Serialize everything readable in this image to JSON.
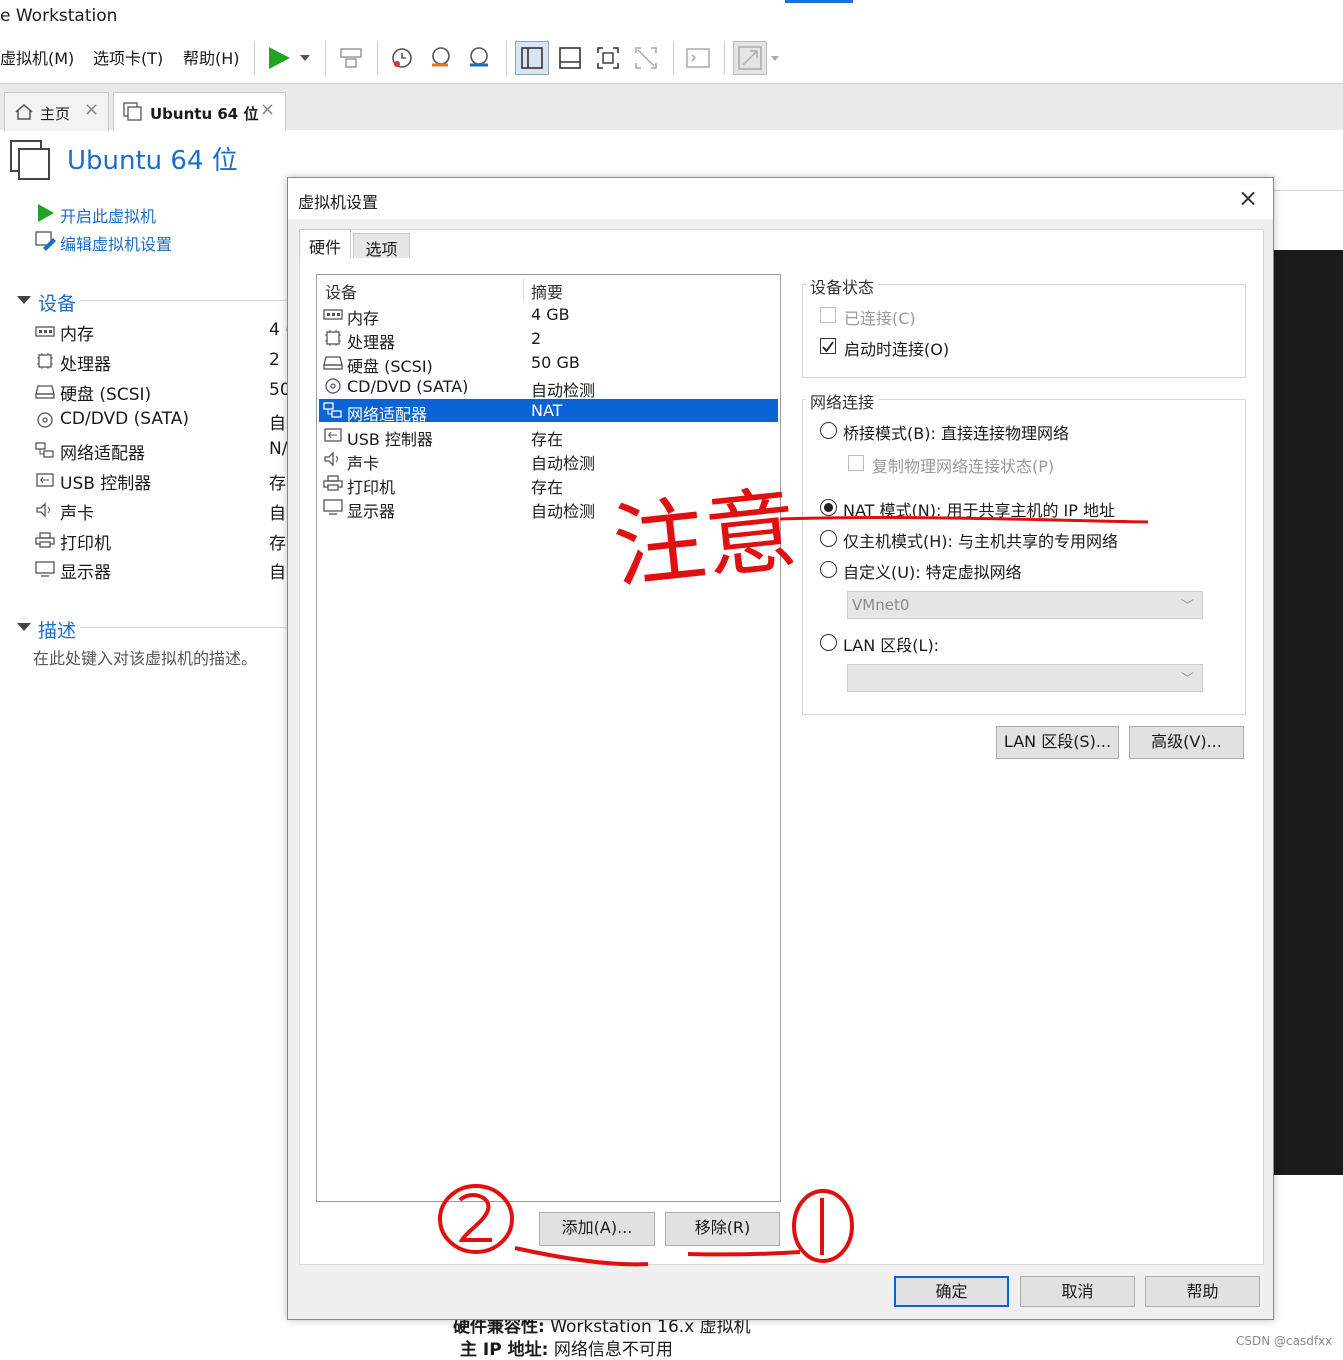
{
  "app": {
    "title": "e Workstation"
  },
  "menu": {
    "vm": "虚拟机(M)",
    "tabs": "选项卡(T)",
    "help": "帮助(H)"
  },
  "tabs": [
    {
      "label": "主页"
    },
    {
      "label": "Ubuntu 64 位"
    }
  ],
  "vm": {
    "title": "Ubuntu 64 位",
    "actions": {
      "power_on": "开启此虚拟机",
      "edit_settings": "编辑虚拟机设置"
    },
    "devices_header": "设备",
    "devices": [
      {
        "name": "内存",
        "value": "4 (",
        "icon": "memory-icon"
      },
      {
        "name": "处理器",
        "value": "2",
        "icon": "cpu-icon"
      },
      {
        "name": "硬盘 (SCSI)",
        "value": "50",
        "icon": "disk-icon"
      },
      {
        "name": "CD/DVD (SATA)",
        "value": "自",
        "icon": "cd-icon"
      },
      {
        "name": "网络适配器",
        "value": "N/",
        "icon": "network-icon"
      },
      {
        "name": "USB 控制器",
        "value": "存",
        "icon": "usb-icon"
      },
      {
        "name": "声卡",
        "value": "自",
        "icon": "sound-icon"
      },
      {
        "name": "打印机",
        "value": "存",
        "icon": "printer-icon"
      },
      {
        "name": "显示器",
        "value": "自",
        "icon": "monitor-icon"
      }
    ],
    "description_header": "描述",
    "description_placeholder": "在此处键入对该虚拟机的描述。",
    "details": [
      {
        "label": "硬件兼容性:",
        "value": "Workstation 16.x 虚拟机"
      },
      {
        "label": "主 IP 地址:",
        "value": "网络信息不可用"
      }
    ]
  },
  "dialog": {
    "title": "虚拟机设置",
    "tabs": {
      "hardware": "硬件",
      "options": "选项"
    },
    "list_headers": {
      "device": "设备",
      "summary": "摘要"
    },
    "devices": [
      {
        "name": "内存",
        "summary": "4 GB",
        "icon": "memory-icon"
      },
      {
        "name": "处理器",
        "summary": "2",
        "icon": "cpu-icon"
      },
      {
        "name": "硬盘 (SCSI)",
        "summary": "50 GB",
        "icon": "disk-icon"
      },
      {
        "name": "CD/DVD (SATA)",
        "summary": "自动检测",
        "icon": "cd-icon"
      },
      {
        "name": "网络适配器",
        "summary": "NAT",
        "icon": "network-icon",
        "selected": true
      },
      {
        "name": "USB 控制器",
        "summary": "存在",
        "icon": "usb-icon"
      },
      {
        "name": "声卡",
        "summary": "自动检测",
        "icon": "sound-icon"
      },
      {
        "name": "打印机",
        "summary": "存在",
        "icon": "printer-icon"
      },
      {
        "name": "显示器",
        "summary": "自动检测",
        "icon": "monitor-icon"
      }
    ],
    "device_status": {
      "label": "设备状态",
      "connected": {
        "label": "已连接(C)",
        "checked": false,
        "enabled": false
      },
      "connect_at_power_on": {
        "label": "启动时连接(O)",
        "checked": true,
        "enabled": true
      }
    },
    "network_connection": {
      "label": "网络连接",
      "bridged": {
        "label": "桥接模式(B): 直接连接物理网络",
        "checked": false
      },
      "replicate": {
        "label": "复制物理网络连接状态(P)",
        "checked": false,
        "enabled": false
      },
      "nat": {
        "label": "NAT 模式(N): 用于共享主机的 IP 地址",
        "checked": true
      },
      "host_only": {
        "label": "仅主机模式(H): 与主机共享的专用网络",
        "checked": false
      },
      "custom": {
        "label": "自定义(U): 特定虚拟网络",
        "checked": false
      },
      "custom_combo": "VMnet0",
      "lan_segment": {
        "label": "LAN 区段(L):",
        "checked": false
      },
      "lan_combo": ""
    },
    "buttons": {
      "lan_segments": "LAN 区段(S)...",
      "advanced": "高级(V)...",
      "add": "添加(A)...",
      "remove": "移除(R)",
      "ok": "确定",
      "cancel": "取消",
      "help": "帮助"
    }
  },
  "annotations": {
    "note": "注意",
    "circle_1": "①",
    "circle_2": "②",
    "color": "#e01010"
  },
  "colors": {
    "accent": "#1a6fc9",
    "selection": "#0a64d6",
    "play": "#22a324"
  },
  "watermark": "CSDN @casdfxx"
}
